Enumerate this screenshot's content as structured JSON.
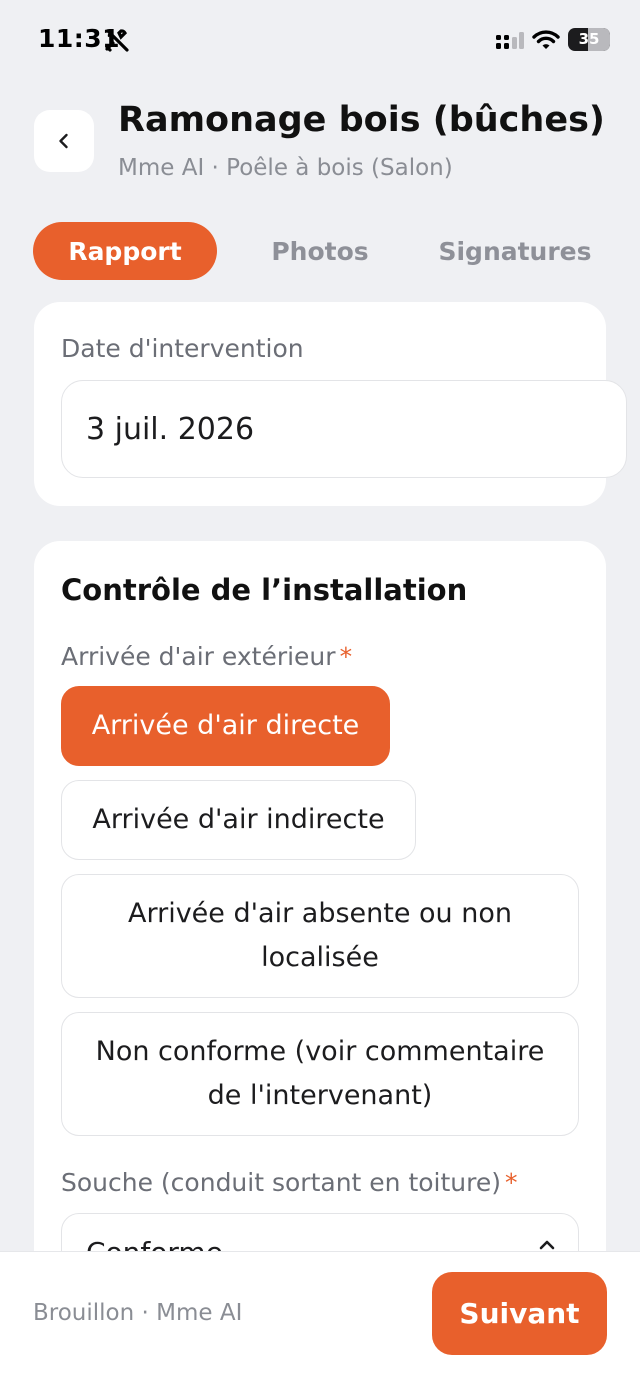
{
  "status_bar": {
    "time": "11:31",
    "battery_level": "35",
    "icons": [
      "tools-icon",
      "cellular-signal-icon",
      "wifi-icon",
      "battery-icon"
    ]
  },
  "header": {
    "back_icon": "chevron-left-icon",
    "title": "Ramonage bois (bûches)",
    "subtitle": "Mme AI · Poêle à bois (Salon)"
  },
  "tabs": [
    {
      "label": "Rapport",
      "active": true
    },
    {
      "label": "Photos",
      "active": false
    },
    {
      "label": "Signatures",
      "active": false
    }
  ],
  "date_card": {
    "label": "Date d'intervention",
    "value": "3 juil. 2026"
  },
  "control_card": {
    "title": "Contrôle de l’installation",
    "air_field": {
      "label": "Arrivée d'air extérieur",
      "required_mark": "*",
      "options": [
        {
          "label": "Arrivée d'air directe",
          "selected": true
        },
        {
          "label": "Arrivée d'air indirecte",
          "selected": false
        },
        {
          "label": "Arrivée d'air absente ou non localisée",
          "selected": false
        },
        {
          "label": "Non conforme (voir commentaire de l'intervenant)",
          "selected": false
        }
      ]
    },
    "souche_field": {
      "label": "Souche (conduit sortant en toiture)",
      "required_mark": "*",
      "value": "Conforme"
    }
  },
  "footer": {
    "status": "Brouillon · Mme AI",
    "next_label": "Suivant"
  },
  "colors": {
    "accent": "#e8602c",
    "background": "#eff0f3",
    "card": "#ffffff",
    "muted_text": "#8a8d94"
  }
}
